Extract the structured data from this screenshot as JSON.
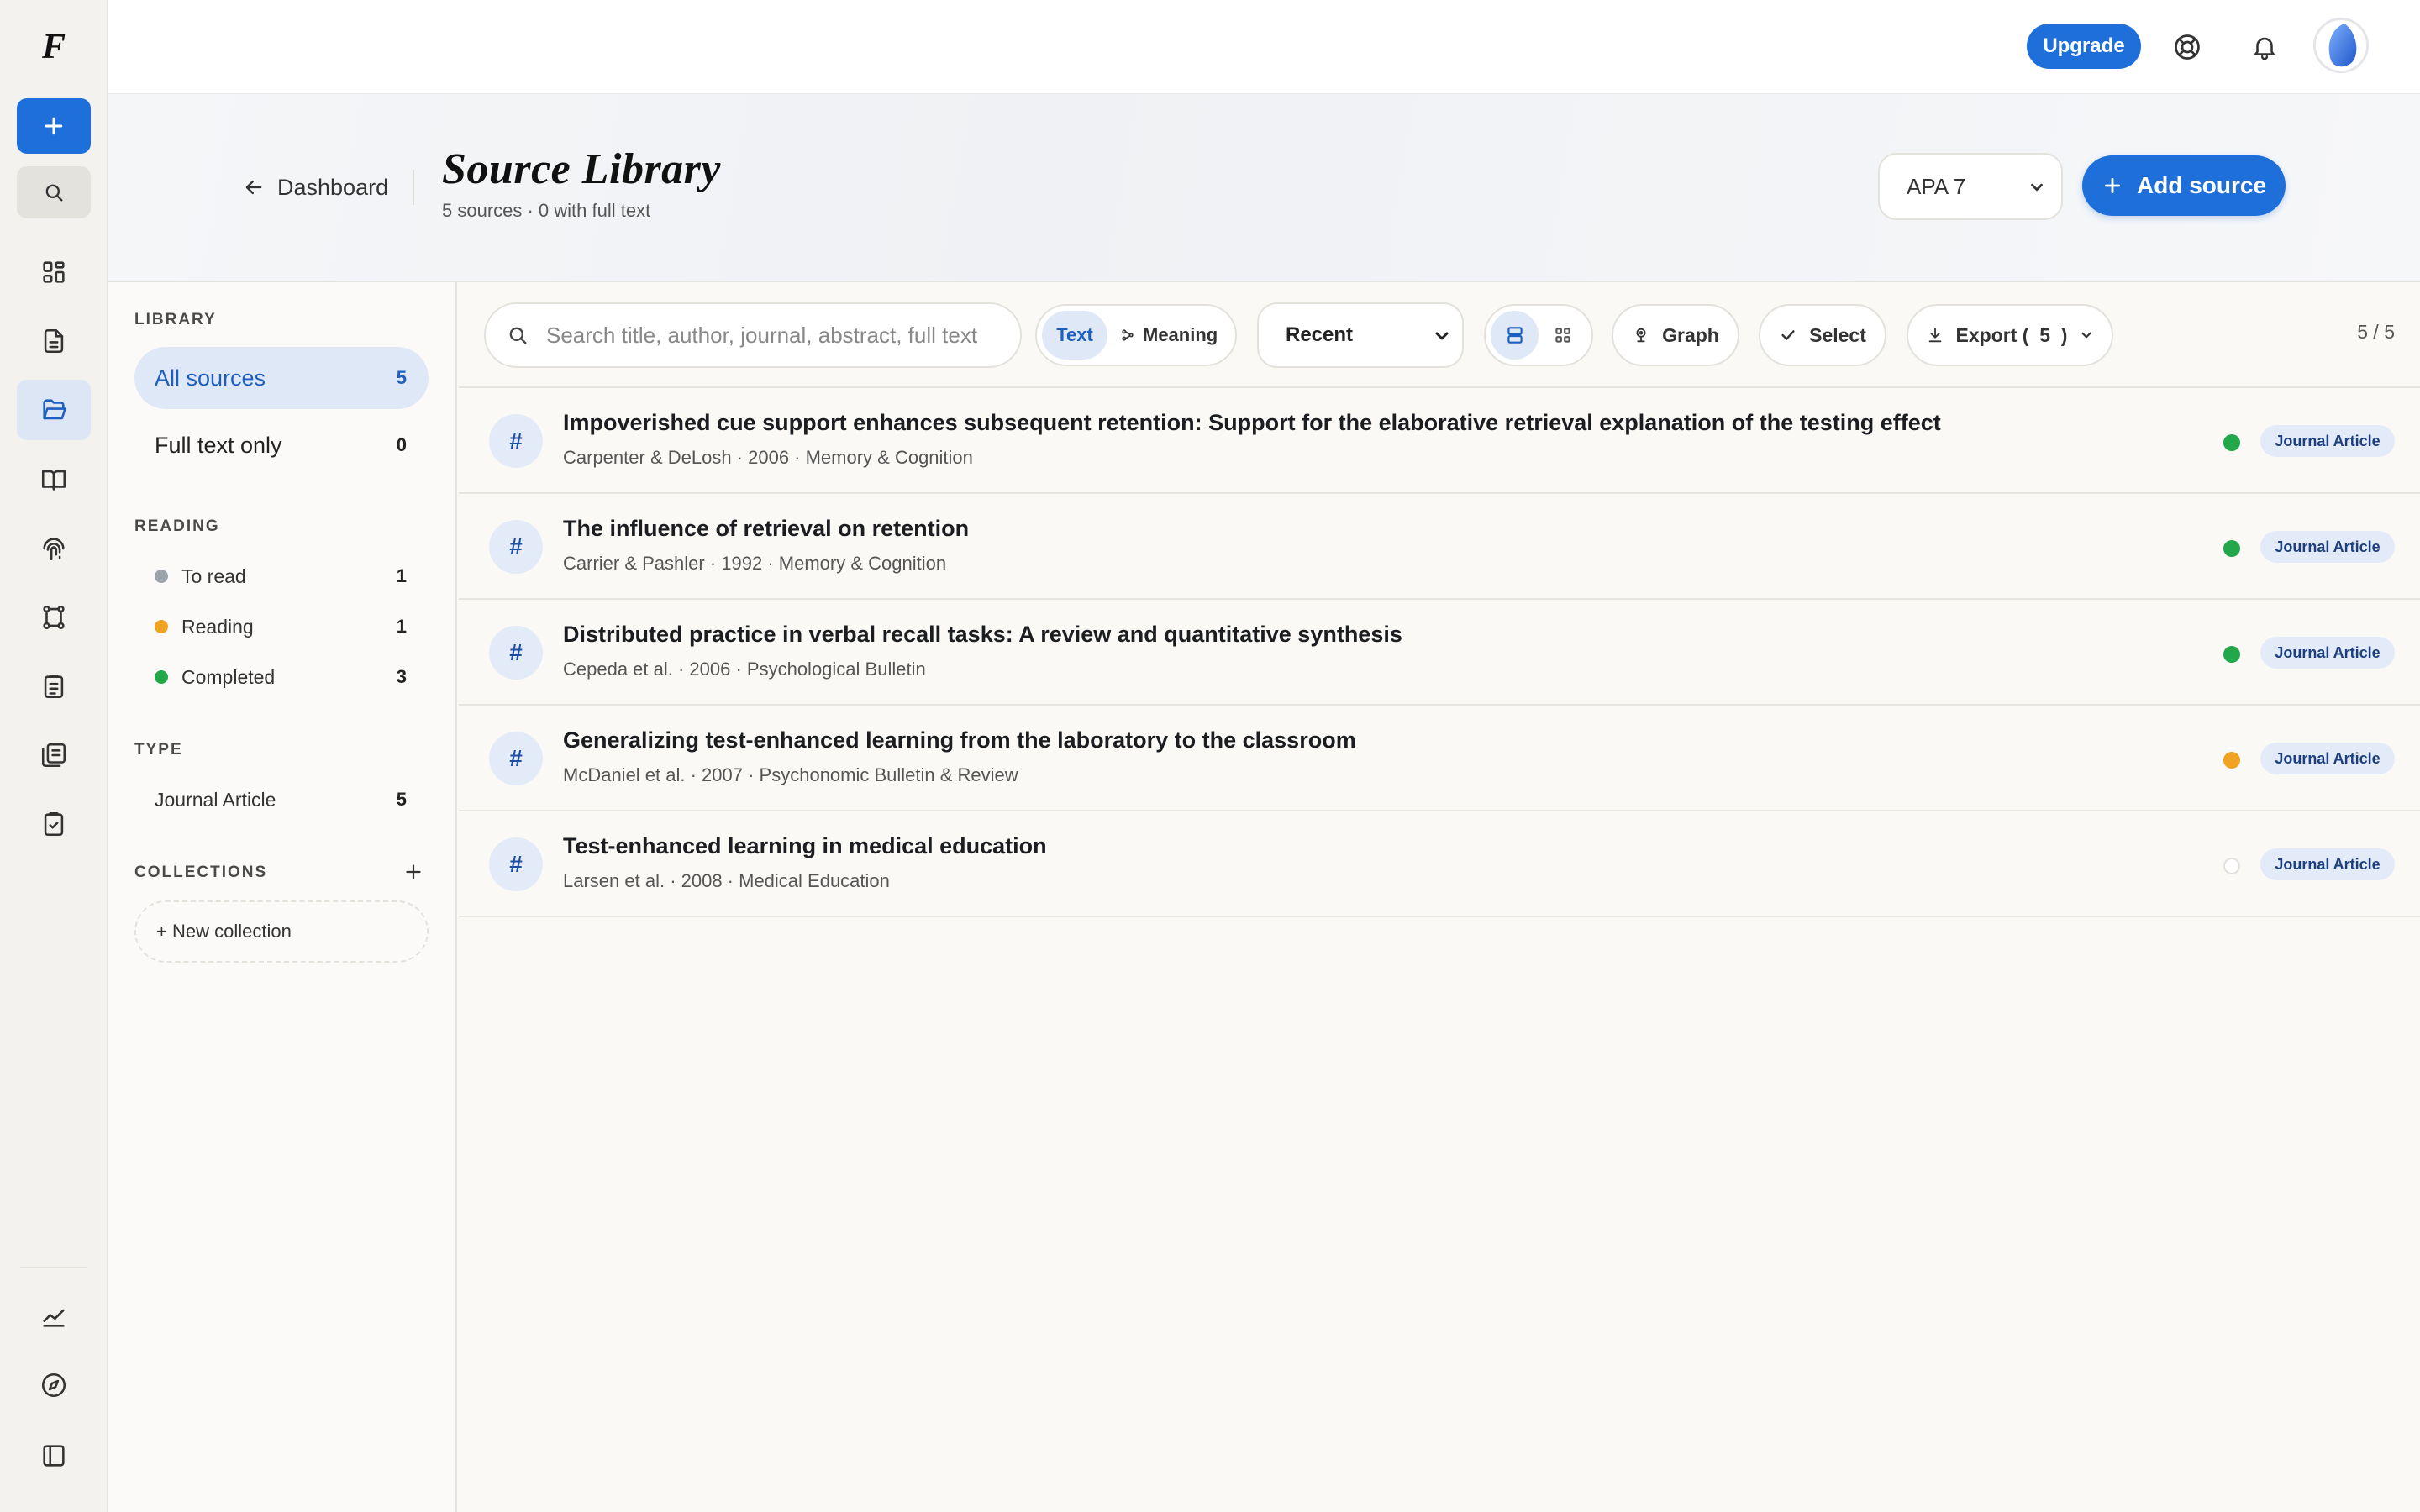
{
  "rail": {
    "logo": "F",
    "icons": [
      "plus-icon",
      "search-icon",
      "dashboard-icon",
      "document-icon",
      "folder-icon",
      "book-icon",
      "fingerprint-icon",
      "workflow-icon",
      "clipboard-icon",
      "library-icon",
      "checklist-icon",
      "chart-icon",
      "compass-icon",
      "panel-icon"
    ]
  },
  "topbar": {
    "upgrade_label": "Upgrade",
    "icons": [
      "help-icon",
      "bell-icon",
      "avatar"
    ]
  },
  "header": {
    "back_label": "Dashboard",
    "title": "Source Library",
    "subtitle": "5 sources · 0 with full text",
    "citation_style": "APA 7",
    "add_source_label": "Add source"
  },
  "sidebar": {
    "library_label": "LIBRARY",
    "library_items": [
      {
        "label": "All sources",
        "count": "5"
      },
      {
        "label": "Full text only",
        "count": "0"
      }
    ],
    "reading_label": "READING",
    "reading_items": [
      {
        "label": "To read",
        "count": "1",
        "color": "#9ca3ab"
      },
      {
        "label": "Reading",
        "count": "1",
        "color": "#f0a323"
      },
      {
        "label": "Completed",
        "count": "3",
        "color": "#22a84a"
      }
    ],
    "type_label": "TYPE",
    "type_items": [
      {
        "label": "Journal Article",
        "count": "5"
      }
    ],
    "collections_label": "COLLECTIONS",
    "new_collection_label": "+ New collection"
  },
  "toolbar": {
    "search_placeholder": "Search title, author, journal, abstract, full text",
    "mode_text": "Text",
    "mode_meaning": "Meaning",
    "sort_value": "Recent",
    "graph_label": "Graph",
    "select_label": "Select",
    "export_label": "Export (  5  )",
    "counter": "5 / 5"
  },
  "sources": [
    {
      "title": "Impoverished cue support enhances subsequent retention: Support for the elaborative retrieval explanation of the testing effect",
      "meta": "Carpenter & DeLosh · 2006 · Memory & Cognition",
      "status_color": "#22a84a",
      "type": "Journal Article"
    },
    {
      "title": "The influence of retrieval on retention",
      "meta": "Carrier & Pashler · 1992 · Memory & Cognition",
      "status_color": "#22a84a",
      "type": "Journal Article"
    },
    {
      "title": "Distributed practice in verbal recall tasks: A review and quantitative synthesis",
      "meta": "Cepeda et al. · 2006 · Psychological Bulletin",
      "status_color": "#22a84a",
      "type": "Journal Article"
    },
    {
      "title": "Generalizing test-enhanced learning from the laboratory to the classroom",
      "meta": "McDaniel et al. · 2007 · Psychonomic Bulletin & Review",
      "status_color": "#f0a323",
      "type": "Journal Article"
    },
    {
      "title": "Test-enhanced learning in medical education",
      "meta": "Larsen et al. · 2008 · Medical Education",
      "status_color": "#ffffff",
      "type": "Journal Article"
    }
  ],
  "colors": {
    "accent": "#1e6fd9",
    "accent_soft": "#dfe8f6"
  }
}
